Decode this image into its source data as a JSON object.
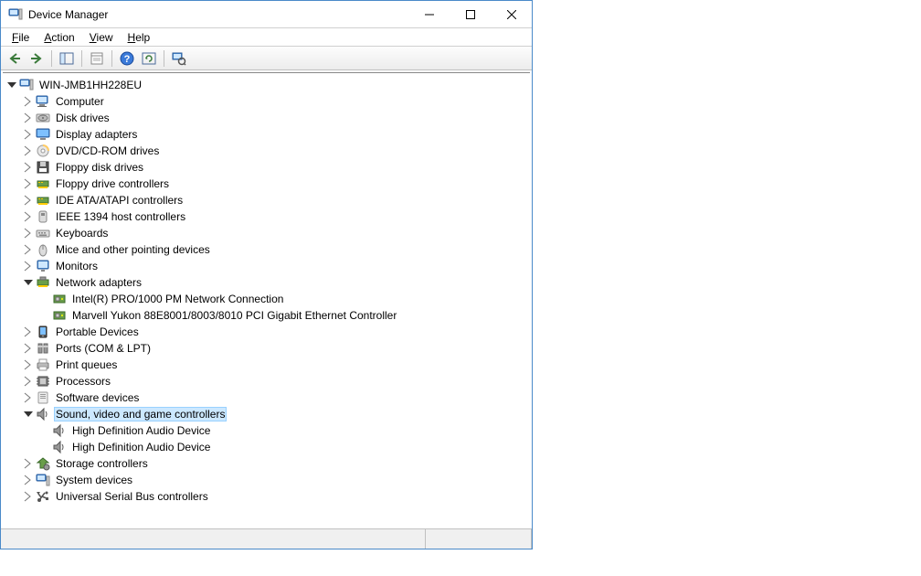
{
  "window": {
    "title": "Device Manager"
  },
  "menu": {
    "file": "File",
    "action": "Action",
    "view": "View",
    "help": "Help"
  },
  "tree": {
    "root": "WIN-JMB1HH228EU",
    "computer": "Computer",
    "disk_drives": "Disk drives",
    "display_adapters": "Display adapters",
    "dvd_cd_rom": "DVD/CD-ROM drives",
    "floppy_disk": "Floppy disk drives",
    "floppy_ctrl": "Floppy drive controllers",
    "ide_atapi": "IDE ATA/ATAPI controllers",
    "ieee1394": "IEEE 1394 host controllers",
    "keyboards": "Keyboards",
    "mice": "Mice and other pointing devices",
    "monitors": "Monitors",
    "network": "Network adapters",
    "net_intel": "Intel(R) PRO/1000 PM Network Connection",
    "net_marvell": "Marvell Yukon 88E8001/8003/8010 PCI Gigabit Ethernet Controller",
    "portable": "Portable Devices",
    "ports": "Ports (COM & LPT)",
    "print_queues": "Print queues",
    "processors": "Processors",
    "software": "Software devices",
    "sound": "Sound, video and game controllers",
    "hda1": "High Definition Audio Device",
    "hda2": "High Definition Audio Device",
    "storage": "Storage controllers",
    "system": "System devices",
    "usb": "Universal Serial Bus controllers"
  }
}
